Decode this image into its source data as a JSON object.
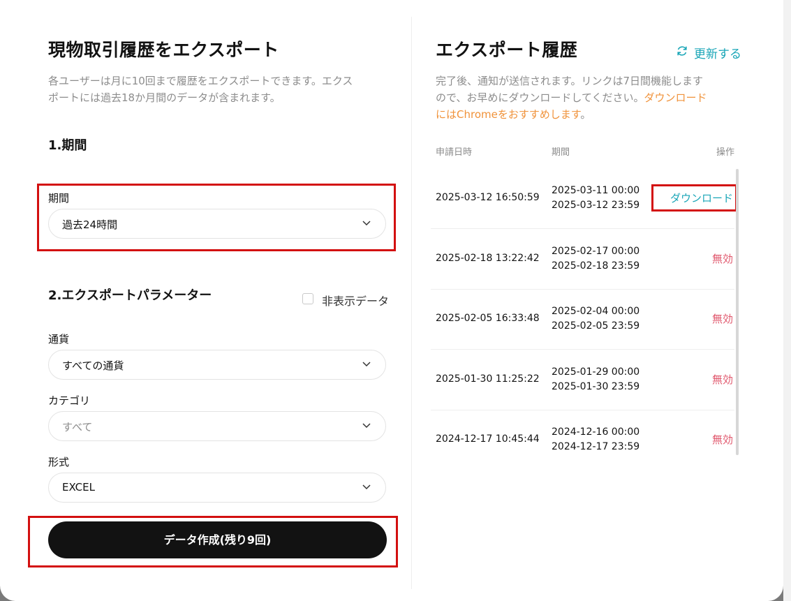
{
  "left": {
    "title": "現物取引履歴をエクスポート",
    "description_line1": "各ユーザーは月に10回まで履歴をエクスポートできます。エクス",
    "description_line2": "ポートには過去18か月間のデータが含まれます。",
    "section1_title": "1.期間",
    "period_label": "期間",
    "period_value": "過去24時間",
    "section2_title": "2.エクスポートパラメーター",
    "hidden_data_label": "非表示データ",
    "currency_label": "通貨",
    "currency_value": "すべての通貨",
    "category_label": "カテゴリ",
    "category_value": "すべて",
    "format_label": "形式",
    "format_value": "EXCEL",
    "create_button": "データ作成(残り9回)"
  },
  "right": {
    "title": "エクスポート履歴",
    "refresh_label": "更新する",
    "description_line1": "完了後、通知が送信されます。リンクは7日間機能します",
    "description_line2_plain": "ので、お早めにダウンロードしてください。",
    "description_line2_orange": "ダウンロード",
    "description_line3_orange": "にはChromeをおすすめします",
    "description_line3_plain": "。",
    "headers": {
      "date": "申請日時",
      "period": "期間",
      "action": "操作"
    },
    "rows": [
      {
        "date": "2025-03-12 16:50:59",
        "period_start": "2025-03-11 00:00",
        "period_end": "2025-03-12 23:59",
        "action": "ダウンロード",
        "status": "download"
      },
      {
        "date": "2025-02-18 13:22:42",
        "period_start": "2025-02-17 00:00",
        "period_end": "2025-02-18 23:59",
        "action": "無効",
        "status": "invalid"
      },
      {
        "date": "2025-02-05 16:33:48",
        "period_start": "2025-02-04 00:00",
        "period_end": "2025-02-05 23:59",
        "action": "無効",
        "status": "invalid"
      },
      {
        "date": "2025-01-30 11:25:22",
        "period_start": "2025-01-29 00:00",
        "period_end": "2025-01-30 23:59",
        "action": "無効",
        "status": "invalid"
      },
      {
        "date": "2024-12-17 10:45:44",
        "period_start": "2024-12-16 00:00",
        "period_end": "2024-12-17 23:59",
        "action": "無効",
        "status": "invalid"
      }
    ]
  },
  "colors": {
    "accent_teal": "#1aa6b7",
    "orange": "#f0923a",
    "invalid_red": "#e0576c",
    "highlight_red": "#d31010",
    "button_dark": "#121212"
  },
  "icons": {
    "chevron": "chevron-down-icon",
    "refresh": "refresh-icon"
  }
}
